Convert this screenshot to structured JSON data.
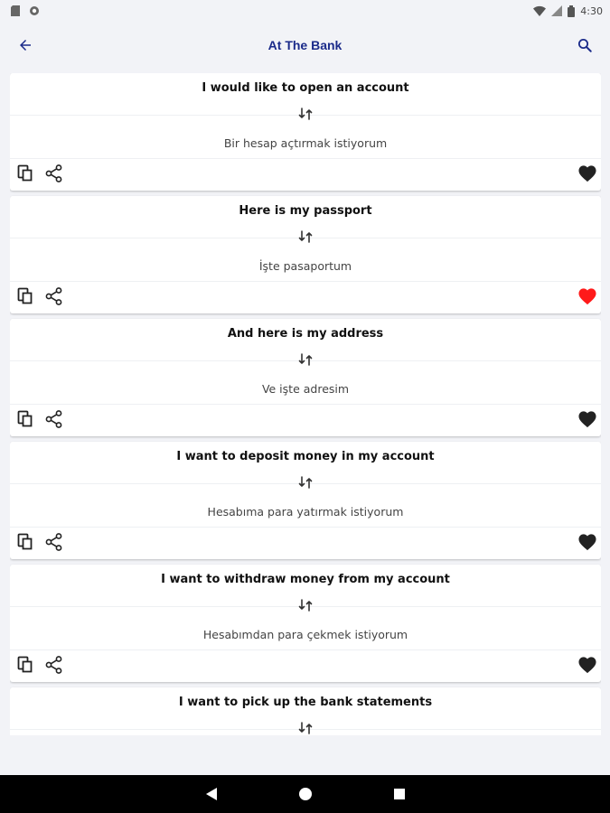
{
  "status_bar": {
    "time": "4:30"
  },
  "app_bar": {
    "title": "At The Bank"
  },
  "colors": {
    "title": "#1b2b8a",
    "favorite_active": "#ff1a1a",
    "favorite_inactive": "#222222"
  },
  "phrases": [
    {
      "english": "I would like to open an account",
      "translation": "Bir hesap açtırmak istiyorum",
      "favorite": false
    },
    {
      "english": "Here is my passport",
      "translation": "İşte pasaportum",
      "favorite": true
    },
    {
      "english": "And here is my address",
      "translation": "Ve işte adresim",
      "favorite": false
    },
    {
      "english": "I want to deposit money in my account",
      "translation": "Hesabıma para yatırmak istiyorum",
      "favorite": false
    },
    {
      "english": "I want to withdraw money from my account",
      "translation": "Hesabımdan para çekmek istiyorum",
      "favorite": false
    },
    {
      "english": "I want to pick up the bank statements",
      "translation": "",
      "favorite": false
    }
  ],
  "icons": {
    "back": "arrow-left-icon",
    "search": "search-icon",
    "swap": "swap-icon",
    "copy": "copy-icon",
    "share": "share-icon",
    "favorite": "heart-icon"
  }
}
